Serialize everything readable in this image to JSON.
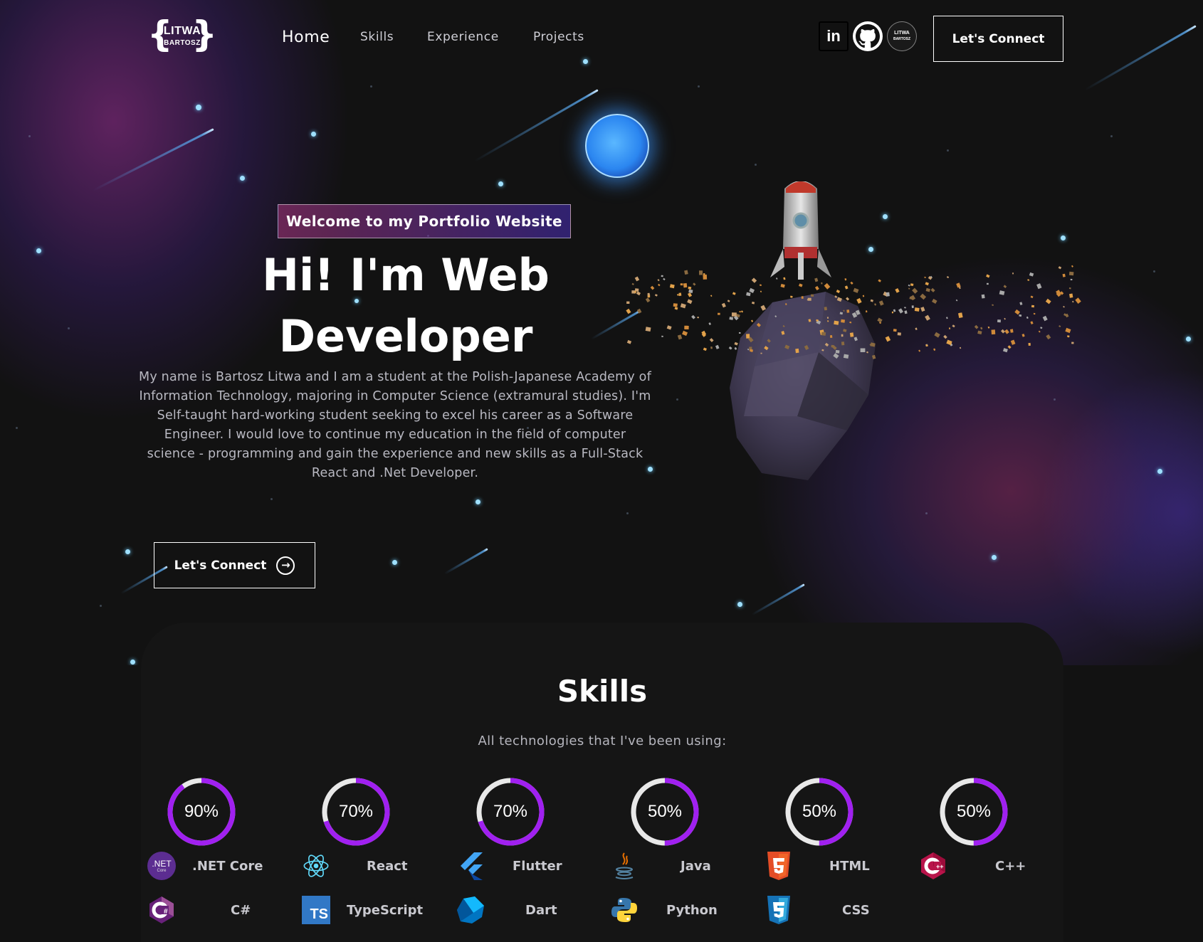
{
  "nav": {
    "logo_line1": "LITWA",
    "logo_line2": "BARTOSZ",
    "links": [
      "Home",
      "Skills",
      "Experience",
      "Projects"
    ],
    "social": {
      "linkedin": "in",
      "github": "github-icon",
      "site_line1": "LITWA",
      "site_line2": "BARTOSZ"
    },
    "connect_label": "Let's Connect"
  },
  "hero": {
    "tagline": "Welcome to my Portfolio Website",
    "headline_line1": "Hi! I'm Web",
    "headline_line2": "Developer",
    "intro": "My name is Bartosz Litwa and I am a student at the Polish-Japanese Academy of Information Technology, majoring in Computer Science (extramural studies). I'm Self-taught hard-working student seeking to excel his career as a Software Engineer. I would love to continue my education in the field of computer science - programming and gain the experience and new skills as a Full-Stack React and .Net Developer.",
    "connect_label": "Let's Connect"
  },
  "skills": {
    "title": "Skills",
    "subtitle": "All technologies that I've been using:",
    "progress": [
      {
        "label": "90%",
        "value": 0.9
      },
      {
        "label": "70%",
        "value": 0.7
      },
      {
        "label": "70%",
        "value": 0.7
      },
      {
        "label": "50%",
        "value": 0.5
      },
      {
        "label": "50%",
        "value": 0.5
      },
      {
        "label": "50%",
        "value": 0.5
      }
    ],
    "row1": [
      ".NET Core",
      "React",
      "Flutter",
      "Java",
      "HTML",
      "C++"
    ],
    "row2": [
      "C#",
      "TypeScript",
      "Dart",
      "Python",
      "CSS"
    ],
    "ring_color": "#a020f0",
    "ring_track": "#e8e8e8",
    "dotnet_icon_text": ".NET",
    "dotnet_icon_sub": "Core",
    "ts_icon_text": "TS"
  },
  "colors": {
    "background": "#121212",
    "accent_purple": "#a020f0",
    "tagline_gradient_start": "#aa367c",
    "tagline_gradient_end": "#4a2fbd"
  }
}
